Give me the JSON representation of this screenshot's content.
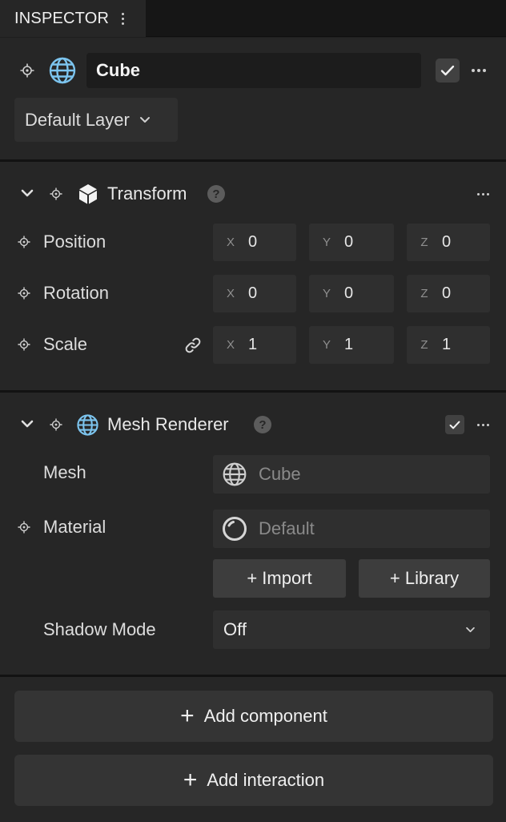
{
  "panel": {
    "title": "INSPECTOR"
  },
  "object": {
    "name": "Cube",
    "enabled": true,
    "layer": "Default Layer"
  },
  "transform": {
    "title": "Transform",
    "help": "?",
    "rows": [
      {
        "label": "Position",
        "x": "0",
        "y": "0",
        "z": "0"
      },
      {
        "label": "Rotation",
        "x": "0",
        "y": "0",
        "z": "0"
      },
      {
        "label": "Scale",
        "x": "1",
        "y": "1",
        "z": "1"
      }
    ],
    "axes": [
      "X",
      "Y",
      "Z"
    ]
  },
  "mesh_renderer": {
    "title": "Mesh Renderer",
    "help": "?",
    "enabled": true,
    "mesh_label": "Mesh",
    "mesh_value": "Cube",
    "material_label": "Material",
    "material_value": "Default",
    "import_label": "+ Import",
    "library_label": "+ Library",
    "shadow_label": "Shadow Mode",
    "shadow_value": "Off"
  },
  "actions": {
    "add_component_plus": "+",
    "add_component": "Add component",
    "add_interaction_plus": "+",
    "add_interaction": "Add interaction"
  },
  "colors": {
    "background": "#1e1e1e",
    "panel": "#262626",
    "field": "#2f2f2f",
    "globe_icon": "#7cc4ee"
  },
  "icons": {
    "tab_menu": "kebab-vertical-icon",
    "target": "target-crosshair-icon",
    "object": "globe-icon",
    "transform": "cube-icon",
    "link": "link-icon",
    "material": "circle-ring-icon",
    "chevron": "chevron-down-icon",
    "more": "ellipsis-horizontal-icon"
  }
}
